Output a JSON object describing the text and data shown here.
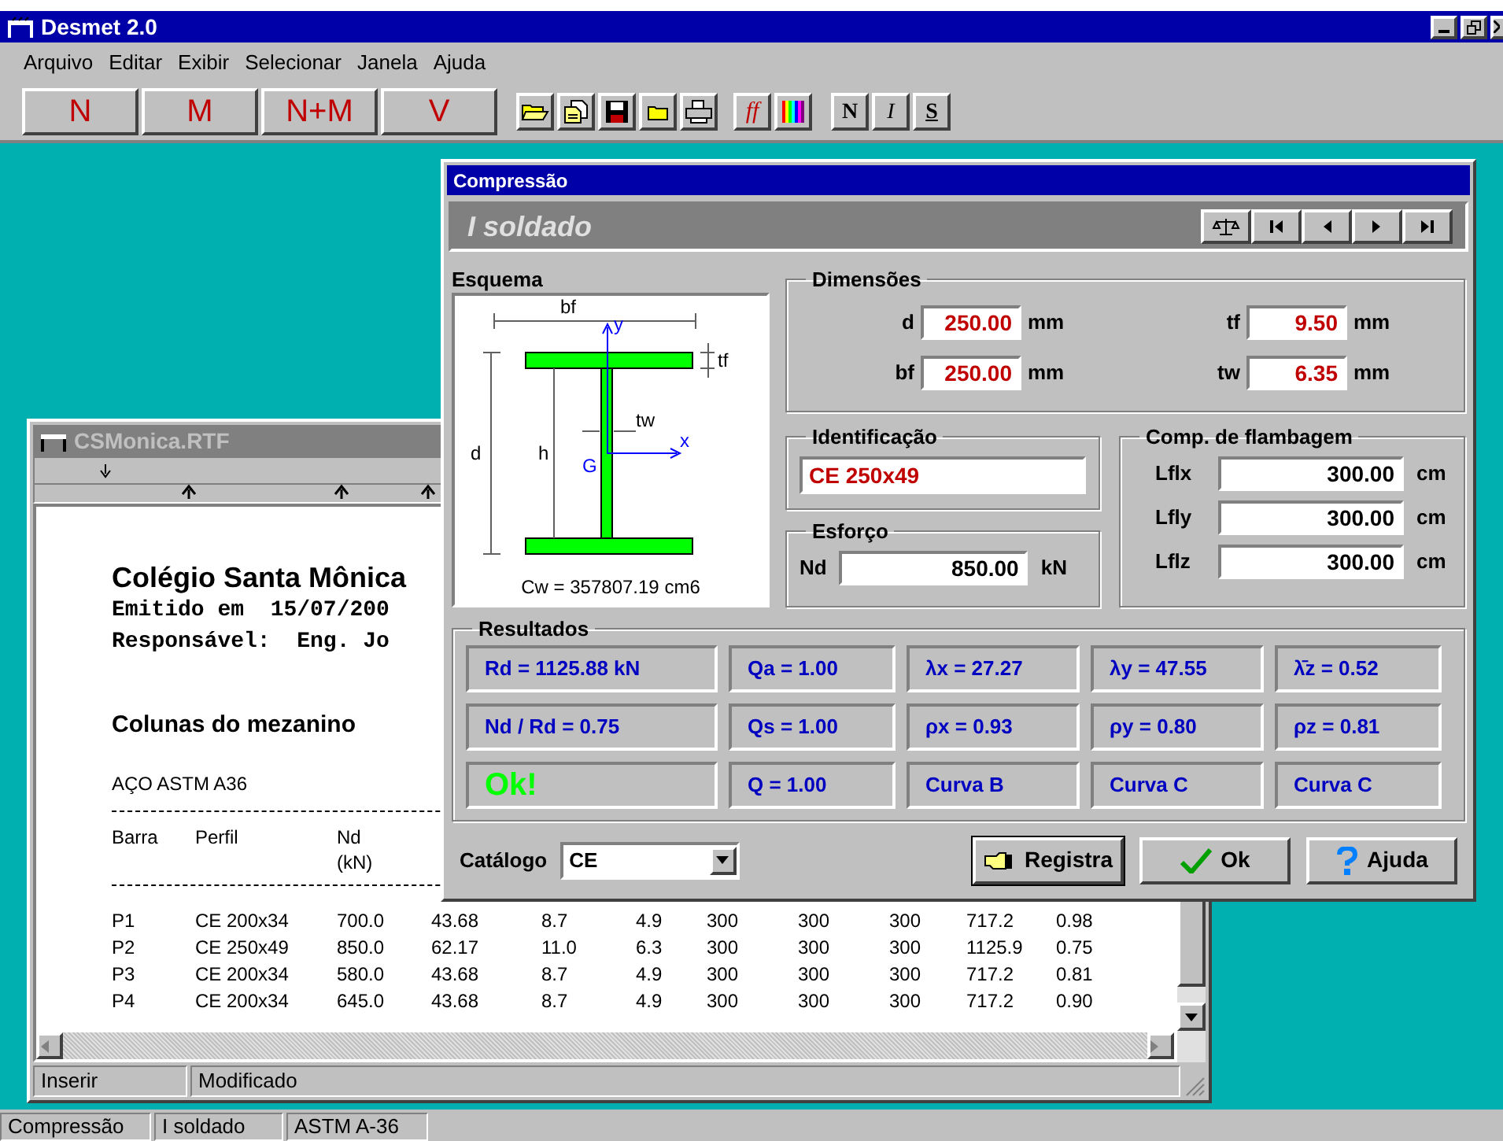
{
  "app_window": {
    "title": "Desmet 2.0"
  },
  "menu": [
    "Arquivo",
    "Editar",
    "Exibir",
    "Selecionar",
    "Janela",
    "Ajuda"
  ],
  "mode_buttons": [
    "N",
    "M",
    "N+M",
    "V"
  ],
  "font_button": "ff",
  "format_buttons": [
    "N",
    "I",
    "S"
  ],
  "document_window": {
    "title": "CSMonica.RTF",
    "heading": "Colégio Santa Mônica",
    "issued": "Emitido em  15/07/200",
    "responsible": "Responsável:  Eng. Jo",
    "section": "Colunas do mezanino",
    "material": "AÇO ASTM A36",
    "columns": [
      "Barra",
      "Perfil",
      "Nd (kN)"
    ],
    "rows": [
      [
        "P1",
        "CE 200x34",
        "700.0",
        "43.68",
        "8.7",
        "4.9",
        "300",
        "300",
        "300",
        "717.2",
        "0.98"
      ],
      [
        "P2",
        "CE 250x49",
        "850.0",
        "62.17",
        "11.0",
        "6.3",
        "300",
        "300",
        "300",
        "1125.9",
        "0.75"
      ],
      [
        "P3",
        "CE 200x34",
        "580.0",
        "43.68",
        "8.7",
        "4.9",
        "300",
        "300",
        "300",
        "717.2",
        "0.81"
      ],
      [
        "P4",
        "CE 200x34",
        "645.0",
        "43.68",
        "8.7",
        "4.9",
        "300",
        "300",
        "300",
        "717.2",
        "0.90"
      ]
    ],
    "status": [
      "Inserir",
      "Modificado"
    ]
  },
  "dialog": {
    "title": "Compressão",
    "profile": "I soldado",
    "esquema": {
      "title": "Esquema",
      "labels": {
        "bf": "bf",
        "tf": "tf",
        "tw": "tw",
        "d": "d",
        "h": "h",
        "G": "G",
        "x": "x",
        "y": "y"
      },
      "cw": "Cw = 357807.19 cm6"
    },
    "dimensions": {
      "title": "Dimensões",
      "fields": [
        {
          "label": "d",
          "value": "250.00",
          "unit": "mm"
        },
        {
          "label": "tf",
          "value": "9.50",
          "unit": "mm"
        },
        {
          "label": "bf",
          "value": "250.00",
          "unit": "mm"
        },
        {
          "label": "tw",
          "value": "6.35",
          "unit": "mm"
        }
      ]
    },
    "identification": {
      "title": "Identificação",
      "value": "CE 250x49"
    },
    "effort": {
      "title": "Esforço",
      "label": "Nd",
      "value": "850.00",
      "unit": "kN"
    },
    "buckling": {
      "title": "Comp. de flambagem",
      "fields": [
        {
          "label": "Lflx",
          "value": "300.00",
          "unit": "cm"
        },
        {
          "label": "Lfly",
          "value": "300.00",
          "unit": "cm"
        },
        {
          "label": "Lflz",
          "value": "300.00",
          "unit": "cm"
        }
      ]
    },
    "results": {
      "title": "Resultados",
      "cells": [
        {
          "text": "Rd = 1125.88 kN",
          "kind": "value"
        },
        {
          "text": "Qa =  1.00",
          "kind": "value"
        },
        {
          "text": "λx = 27.27",
          "kind": "value"
        },
        {
          "text": "λy = 47.55",
          "kind": "value"
        },
        {
          "text": "λ̄z =  0.52",
          "kind": "value"
        },
        {
          "text": "Nd / Rd =  0.75",
          "kind": "value"
        },
        {
          "text": "Qs =  1.00",
          "kind": "value"
        },
        {
          "text": "ρx =  0.93",
          "kind": "value"
        },
        {
          "text": "ρy =  0.80",
          "kind": "value"
        },
        {
          "text": "ρz =  0.81",
          "kind": "value"
        },
        {
          "text": "Ok!",
          "kind": "ok"
        },
        {
          "text": "Q  =  1.00",
          "kind": "value"
        },
        {
          "text": "Curva B",
          "kind": "value"
        },
        {
          "text": "Curva C",
          "kind": "value"
        },
        {
          "text": "Curva C",
          "kind": "value"
        }
      ]
    },
    "catalog": {
      "label": "Catálogo",
      "value": "CE"
    },
    "buttons": [
      {
        "label": "Registra",
        "focused": true
      },
      {
        "label": "Ok",
        "focused": false
      },
      {
        "label": "Ajuda",
        "focused": false
      }
    ]
  },
  "status_bar": [
    "Compressão",
    "I soldado",
    "ASTM A-36"
  ]
}
